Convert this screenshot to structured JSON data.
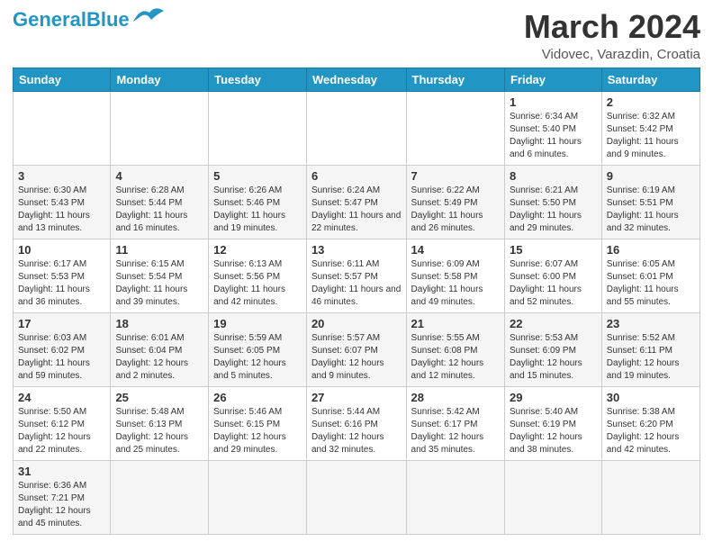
{
  "header": {
    "logo_general": "General",
    "logo_blue": "Blue",
    "month_title": "March 2024",
    "location": "Vidovec, Varazdin, Croatia"
  },
  "days_of_week": [
    "Sunday",
    "Monday",
    "Tuesday",
    "Wednesday",
    "Thursday",
    "Friday",
    "Saturday"
  ],
  "weeks": [
    {
      "days": [
        {
          "num": "",
          "info": ""
        },
        {
          "num": "",
          "info": ""
        },
        {
          "num": "",
          "info": ""
        },
        {
          "num": "",
          "info": ""
        },
        {
          "num": "",
          "info": ""
        },
        {
          "num": "1",
          "info": "Sunrise: 6:34 AM\nSunset: 5:40 PM\nDaylight: 11 hours and 6 minutes."
        },
        {
          "num": "2",
          "info": "Sunrise: 6:32 AM\nSunset: 5:42 PM\nDaylight: 11 hours and 9 minutes."
        }
      ]
    },
    {
      "days": [
        {
          "num": "3",
          "info": "Sunrise: 6:30 AM\nSunset: 5:43 PM\nDaylight: 11 hours and 13 minutes."
        },
        {
          "num": "4",
          "info": "Sunrise: 6:28 AM\nSunset: 5:44 PM\nDaylight: 11 hours and 16 minutes."
        },
        {
          "num": "5",
          "info": "Sunrise: 6:26 AM\nSunset: 5:46 PM\nDaylight: 11 hours and 19 minutes."
        },
        {
          "num": "6",
          "info": "Sunrise: 6:24 AM\nSunset: 5:47 PM\nDaylight: 11 hours and 22 minutes."
        },
        {
          "num": "7",
          "info": "Sunrise: 6:22 AM\nSunset: 5:49 PM\nDaylight: 11 hours and 26 minutes."
        },
        {
          "num": "8",
          "info": "Sunrise: 6:21 AM\nSunset: 5:50 PM\nDaylight: 11 hours and 29 minutes."
        },
        {
          "num": "9",
          "info": "Sunrise: 6:19 AM\nSunset: 5:51 PM\nDaylight: 11 hours and 32 minutes."
        }
      ]
    },
    {
      "days": [
        {
          "num": "10",
          "info": "Sunrise: 6:17 AM\nSunset: 5:53 PM\nDaylight: 11 hours and 36 minutes."
        },
        {
          "num": "11",
          "info": "Sunrise: 6:15 AM\nSunset: 5:54 PM\nDaylight: 11 hours and 39 minutes."
        },
        {
          "num": "12",
          "info": "Sunrise: 6:13 AM\nSunset: 5:56 PM\nDaylight: 11 hours and 42 minutes."
        },
        {
          "num": "13",
          "info": "Sunrise: 6:11 AM\nSunset: 5:57 PM\nDaylight: 11 hours and 46 minutes."
        },
        {
          "num": "14",
          "info": "Sunrise: 6:09 AM\nSunset: 5:58 PM\nDaylight: 11 hours and 49 minutes."
        },
        {
          "num": "15",
          "info": "Sunrise: 6:07 AM\nSunset: 6:00 PM\nDaylight: 11 hours and 52 minutes."
        },
        {
          "num": "16",
          "info": "Sunrise: 6:05 AM\nSunset: 6:01 PM\nDaylight: 11 hours and 55 minutes."
        }
      ]
    },
    {
      "days": [
        {
          "num": "17",
          "info": "Sunrise: 6:03 AM\nSunset: 6:02 PM\nDaylight: 11 hours and 59 minutes."
        },
        {
          "num": "18",
          "info": "Sunrise: 6:01 AM\nSunset: 6:04 PM\nDaylight: 12 hours and 2 minutes."
        },
        {
          "num": "19",
          "info": "Sunrise: 5:59 AM\nSunset: 6:05 PM\nDaylight: 12 hours and 5 minutes."
        },
        {
          "num": "20",
          "info": "Sunrise: 5:57 AM\nSunset: 6:07 PM\nDaylight: 12 hours and 9 minutes."
        },
        {
          "num": "21",
          "info": "Sunrise: 5:55 AM\nSunset: 6:08 PM\nDaylight: 12 hours and 12 minutes."
        },
        {
          "num": "22",
          "info": "Sunrise: 5:53 AM\nSunset: 6:09 PM\nDaylight: 12 hours and 15 minutes."
        },
        {
          "num": "23",
          "info": "Sunrise: 5:52 AM\nSunset: 6:11 PM\nDaylight: 12 hours and 19 minutes."
        }
      ]
    },
    {
      "days": [
        {
          "num": "24",
          "info": "Sunrise: 5:50 AM\nSunset: 6:12 PM\nDaylight: 12 hours and 22 minutes."
        },
        {
          "num": "25",
          "info": "Sunrise: 5:48 AM\nSunset: 6:13 PM\nDaylight: 12 hours and 25 minutes."
        },
        {
          "num": "26",
          "info": "Sunrise: 5:46 AM\nSunset: 6:15 PM\nDaylight: 12 hours and 29 minutes."
        },
        {
          "num": "27",
          "info": "Sunrise: 5:44 AM\nSunset: 6:16 PM\nDaylight: 12 hours and 32 minutes."
        },
        {
          "num": "28",
          "info": "Sunrise: 5:42 AM\nSunset: 6:17 PM\nDaylight: 12 hours and 35 minutes."
        },
        {
          "num": "29",
          "info": "Sunrise: 5:40 AM\nSunset: 6:19 PM\nDaylight: 12 hours and 38 minutes."
        },
        {
          "num": "30",
          "info": "Sunrise: 5:38 AM\nSunset: 6:20 PM\nDaylight: 12 hours and 42 minutes."
        }
      ]
    },
    {
      "days": [
        {
          "num": "31",
          "info": "Sunrise: 6:36 AM\nSunset: 7:21 PM\nDaylight: 12 hours and 45 minutes."
        },
        {
          "num": "",
          "info": ""
        },
        {
          "num": "",
          "info": ""
        },
        {
          "num": "",
          "info": ""
        },
        {
          "num": "",
          "info": ""
        },
        {
          "num": "",
          "info": ""
        },
        {
          "num": "",
          "info": ""
        }
      ]
    }
  ]
}
